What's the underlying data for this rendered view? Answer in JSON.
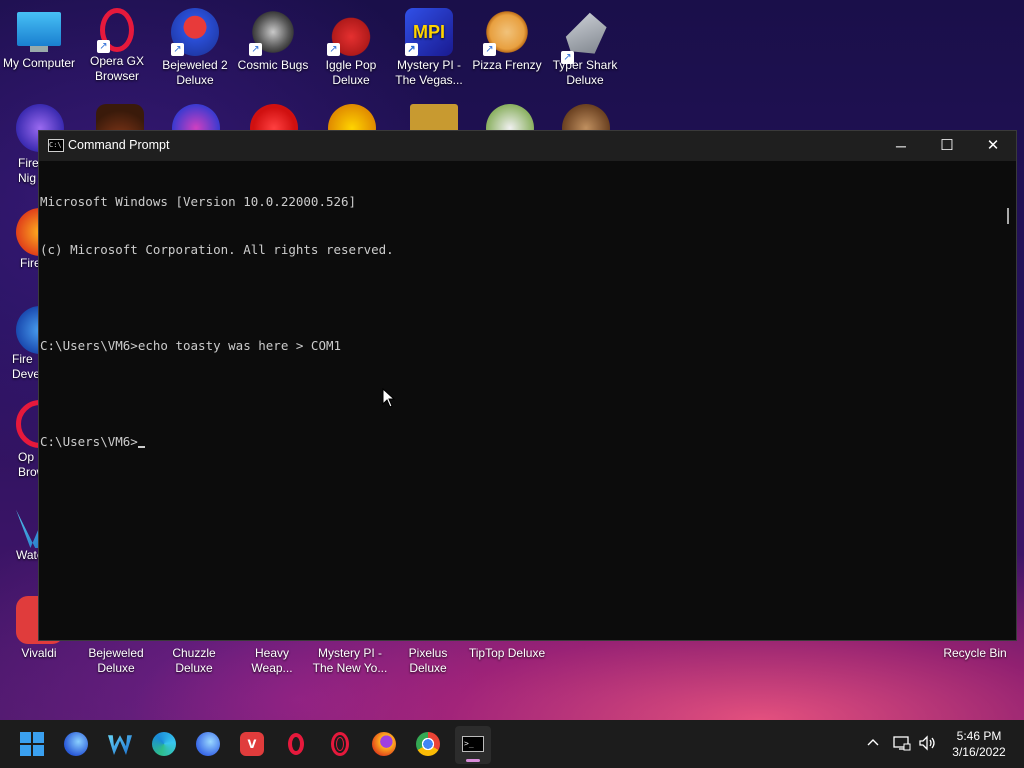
{
  "desktop": {
    "top_icons": [
      {
        "label": "My Computer",
        "icon": "monitor-icon",
        "color": "#2aa6e8"
      },
      {
        "label": "Opera GX Browser",
        "icon": "opera-gx-icon",
        "color": "#e6193c"
      },
      {
        "label": "Bejeweled 2 Deluxe",
        "icon": "bejeweled-2-icon",
        "color": "#3b5fe0"
      },
      {
        "label": "Cosmic Bugs",
        "icon": "gear-bug-icon",
        "color": "#7a7a7a"
      },
      {
        "label": "Iggle Pop Deluxe",
        "icon": "iggle-pop-icon",
        "color": "#d62a2a"
      },
      {
        "label": "Mystery PI - The Vegas...",
        "icon": "mystery-pi-icon",
        "color": "#2a3bd6"
      },
      {
        "label": "Pizza Frenzy",
        "icon": "pizza-icon",
        "color": "#e0a040"
      },
      {
        "label": "Typer Shark Deluxe",
        "icon": "shark-icon",
        "color": "#9aa0a8"
      }
    ],
    "left_partial": [
      {
        "label": "Fire\nNig",
        "color": "#6a3fd0"
      },
      {
        "label": "Fire",
        "color": "#ff7a1a"
      },
      {
        "label": "Fire\nDeve",
        "color": "#2f8ae0"
      },
      {
        "label": "Op\nBrow",
        "color": "#e6193c"
      },
      {
        "label": "Wate",
        "color": "#36a7e8"
      }
    ],
    "bottom_icons": [
      {
        "label": "Vivaldi"
      },
      {
        "label": "Bejeweled Deluxe"
      },
      {
        "label": "Chuzzle Deluxe"
      },
      {
        "label": "Heavy Weap..."
      },
      {
        "label": "Mystery PI - The New Yo..."
      },
      {
        "label": "Pixelus Deluxe"
      },
      {
        "label": "TipTop Deluxe"
      }
    ],
    "recycle_bin": "Recycle Bin"
  },
  "window": {
    "title": "Command Prompt",
    "controls": {
      "minimize": "─",
      "maximize": "☐",
      "close": "✕"
    },
    "console_lines": [
      "Microsoft Windows [Version 10.0.22000.526]",
      "(c) Microsoft Corporation. All rights reserved.",
      "",
      "C:\\Users\\VM6>echo toasty was here > COM1",
      "",
      "C:\\Users\\VM6>"
    ]
  },
  "taskbar": {
    "apps": [
      {
        "name": "start-button",
        "icon": "windows-logo-icon",
        "color": "#3aa0f0"
      },
      {
        "name": "firefox-nightly",
        "icon": "firefox-nightly-icon",
        "color": "#3b7be8"
      },
      {
        "name": "waterfox",
        "icon": "waterfox-icon",
        "color": "#3aa7e8"
      },
      {
        "name": "edge",
        "icon": "edge-icon",
        "color": "#2ebd8a"
      },
      {
        "name": "firefox-developer",
        "icon": "firefox-dev-icon",
        "color": "#3f7ee8"
      },
      {
        "name": "vivaldi",
        "icon": "vivaldi-icon",
        "color": "#e03c3c"
      },
      {
        "name": "opera",
        "icon": "opera-icon",
        "color": "#e6193c"
      },
      {
        "name": "opera-gx",
        "icon": "opera-gx-icon",
        "color": "#e6193c"
      },
      {
        "name": "firefox",
        "icon": "firefox-icon",
        "color": "#ff8a1a"
      },
      {
        "name": "chrome",
        "icon": "chrome-icon",
        "color": "#4caf50"
      },
      {
        "name": "command-prompt",
        "icon": "terminal-icon",
        "color": "#1a1a1a"
      }
    ],
    "time": "5:46 PM",
    "date": "3/16/2022"
  }
}
